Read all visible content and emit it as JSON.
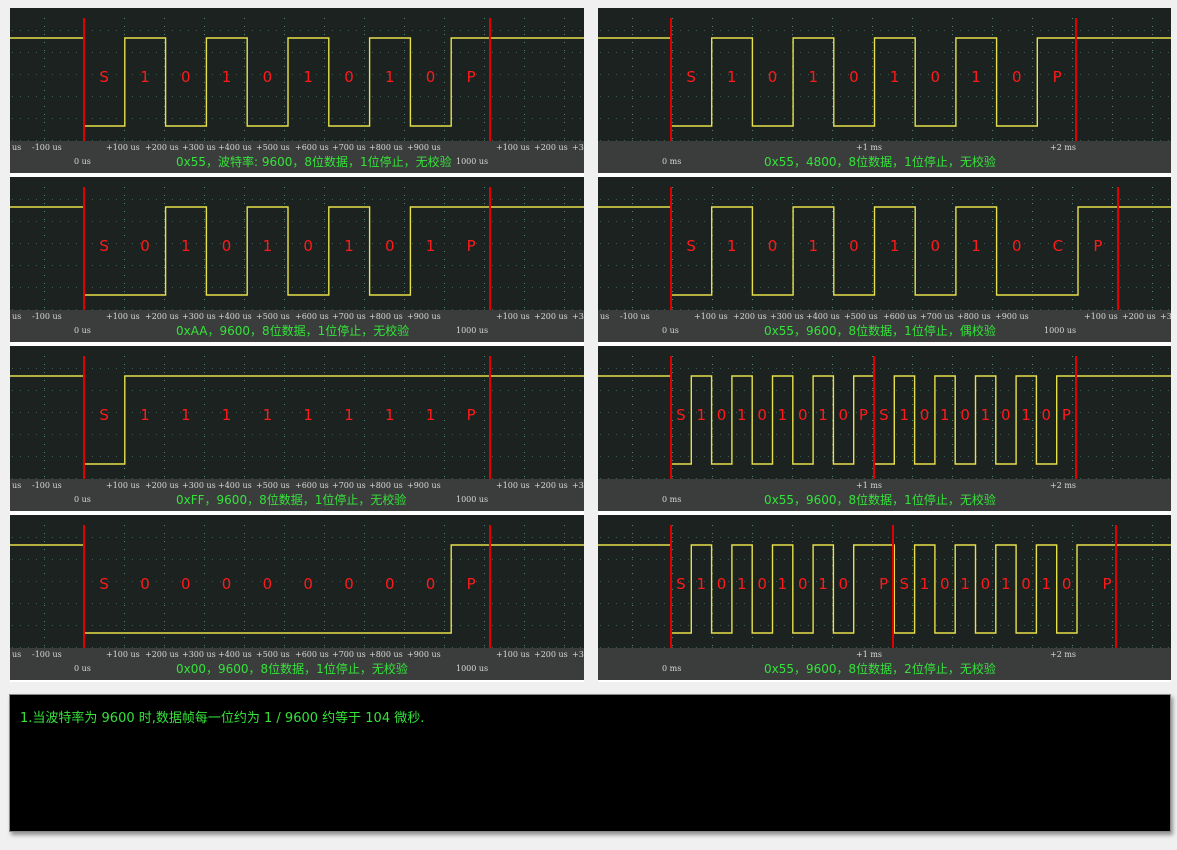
{
  "colors": {
    "signal": "#e6e04a",
    "marker": "#e00000",
    "label": "#ff1a1a",
    "caption": "#35e23a",
    "grid": "#4a8a78"
  },
  "panels": [
    {
      "id": "p1",
      "side": "left",
      "caption": "0x55，波特率: 9600，8位数据，1位停止，无校验",
      "bits": [
        0,
        1,
        0,
        1,
        0,
        1,
        0,
        1,
        0,
        1
      ],
      "labels": [
        "S",
        "1",
        "0",
        "1",
        "0",
        "1",
        "0",
        "1",
        "0",
        "P"
      ],
      "ticks_left": [
        "us",
        "-100 us",
        "+100 us",
        "+200 us",
        "+300 us",
        "+400 us",
        "+500 us",
        "+600 us",
        "+700 us",
        "+800 us",
        "+900 us",
        "+100 us",
        "+200 us",
        "+3"
      ],
      "zero": "0 us",
      "end": "1000 us"
    },
    {
      "id": "p2",
      "side": "left",
      "caption": "0xAA，9600，8位数据，1位停止，无校验",
      "bits": [
        0,
        0,
        1,
        0,
        1,
        0,
        1,
        0,
        1,
        1
      ],
      "labels": [
        "S",
        "0",
        "1",
        "0",
        "1",
        "0",
        "1",
        "0",
        "1",
        "P"
      ],
      "ticks_left": [
        "us",
        "-100 us",
        "+100 us",
        "+200 us",
        "+300 us",
        "+400 us",
        "+500 us",
        "+600 us",
        "+700 us",
        "+800 us",
        "+900 us",
        "+100 us",
        "+200 us",
        "+3"
      ],
      "zero": "0 us",
      "end": "1000 us"
    },
    {
      "id": "p3",
      "side": "left",
      "caption": "0xFF，9600，8位数据，1位停止，无校验",
      "bits": [
        0,
        1,
        1,
        1,
        1,
        1,
        1,
        1,
        1,
        1
      ],
      "labels": [
        "S",
        "1",
        "1",
        "1",
        "1",
        "1",
        "1",
        "1",
        "1",
        "P"
      ],
      "ticks_left": [
        "us",
        "-100 us",
        "+100 us",
        "+200 us",
        "+300 us",
        "+400 us",
        "+500 us",
        "+600 us",
        "+700 us",
        "+800 us",
        "+900 us",
        "+100 us",
        "+200 us",
        "+3"
      ],
      "zero": "0 us",
      "end": "1000 us"
    },
    {
      "id": "p4",
      "side": "left",
      "caption": "0x00，9600，8位数据，1位停止，无校验",
      "bits": [
        0,
        0,
        0,
        0,
        0,
        0,
        0,
        0,
        0,
        1
      ],
      "labels": [
        "S",
        "0",
        "0",
        "0",
        "0",
        "0",
        "0",
        "0",
        "0",
        "P"
      ],
      "ticks_left": [
        "us",
        "-100 us",
        "+100 us",
        "+200 us",
        "+300 us",
        "+400 us",
        "+500 us",
        "+600 us",
        "+700 us",
        "+800 us",
        "+900 us",
        "+100 us",
        "+200 us",
        "+3"
      ],
      "zero": "0 us",
      "end": "1000 us"
    },
    {
      "id": "p5",
      "side": "right",
      "caption": "0x55，4800，8位数据，1位停止，无校验",
      "bits": [
        0,
        1,
        0,
        1,
        0,
        1,
        0,
        1,
        0,
        1
      ],
      "labels": [
        "S",
        "1",
        "0",
        "1",
        "0",
        "1",
        "0",
        "1",
        "0",
        "P"
      ],
      "ticks_left": [
        "+1 ms",
        "+2 ms"
      ],
      "zero": "0 ms",
      "end": ""
    },
    {
      "id": "p6",
      "side": "right",
      "caption": "0x55，9600，8位数据，1位停止，偶校验",
      "bits": [
        0,
        1,
        0,
        1,
        0,
        1,
        0,
        1,
        0,
        0,
        1
      ],
      "labels": [
        "S",
        "1",
        "0",
        "1",
        "0",
        "1",
        "0",
        "1",
        "0",
        "C",
        "P"
      ],
      "ticks_left": [
        "us",
        "-100 us",
        "+100 us",
        "+200 us",
        "+300 us",
        "+400 us",
        "+500 us",
        "+600 us",
        "+700 us",
        "+800 us",
        "+900 us",
        "+100 us",
        "+200 us",
        "+3"
      ],
      "zero": "0 us",
      "end": "1000 us"
    },
    {
      "id": "p7",
      "side": "right",
      "caption": "0x55，9600，8位数据，1位停止，无校验",
      "bits": [
        0,
        1,
        0,
        1,
        0,
        1,
        0,
        1,
        0,
        1,
        0,
        1,
        0,
        1,
        0,
        1,
        0,
        1,
        0,
        1
      ],
      "labels": [
        "S",
        "1",
        "0",
        "1",
        "0",
        "1",
        "0",
        "1",
        "0",
        "P",
        "S",
        "1",
        "0",
        "1",
        "0",
        "1",
        "0",
        "1",
        "0",
        "P"
      ],
      "ticks_left": [
        "+1 ms",
        "+2 ms"
      ],
      "zero": "0 ms",
      "end": ""
    },
    {
      "id": "p8",
      "side": "right",
      "caption": "0x55，9600，8位数据，2位停止，无校验",
      "bits": [
        0,
        1,
        0,
        1,
        0,
        1,
        0,
        1,
        0,
        1,
        1,
        0,
        1,
        0,
        1,
        0,
        1,
        0,
        1,
        0,
        1,
        1
      ],
      "labels": [
        "S",
        "1",
        "0",
        "1",
        "0",
        "1",
        "0",
        "1",
        "0",
        "",
        "P",
        "S",
        "1",
        "0",
        "1",
        "0",
        "1",
        "0",
        "1",
        "0",
        "",
        "P"
      ],
      "ticks_left": [
        "+1 ms",
        "+2 ms"
      ],
      "zero": "0 ms",
      "end": ""
    }
  ],
  "note": {
    "text": "1.当波特率为 9600 时,数据帧每一位约为 1 / 9600  约等于 104 微秒."
  }
}
